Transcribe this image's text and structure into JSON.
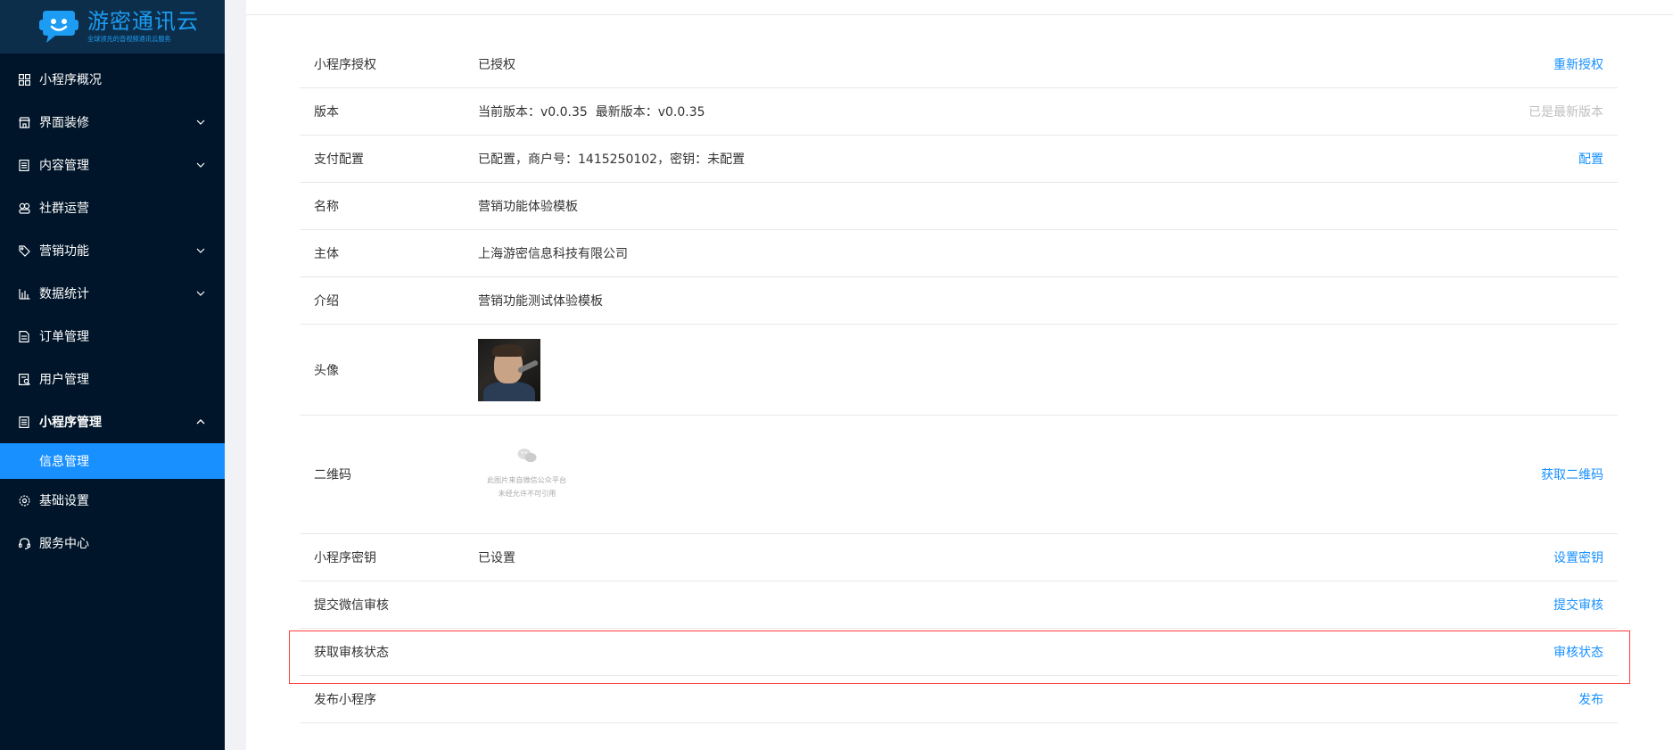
{
  "brand": {
    "title": "游密通讯云",
    "subtitle": "全球领先的音视频通讯云服务"
  },
  "colors": {
    "sidebar_bg": "#001529",
    "active_bg": "#1890ff",
    "link": "#1890ff",
    "highlight_border": "#ff3b3b"
  },
  "sidebar": {
    "items": [
      {
        "label": "小程序概况",
        "icon": "dashboard-icon",
        "chevron": false
      },
      {
        "label": "界面装修",
        "icon": "shop-icon",
        "chevron": true
      },
      {
        "label": "内容管理",
        "icon": "document-icon",
        "chevron": true
      },
      {
        "label": "社群运营",
        "icon": "community-icon",
        "chevron": false
      },
      {
        "label": "营销功能",
        "icon": "tag-icon",
        "chevron": true
      },
      {
        "label": "数据统计",
        "icon": "bar-chart-icon",
        "chevron": true
      },
      {
        "label": "订单管理",
        "icon": "order-icon",
        "chevron": false
      },
      {
        "label": "用户管理",
        "icon": "user-manage-icon",
        "chevron": false
      },
      {
        "label": "小程序管理",
        "icon": "miniprogram-icon",
        "chevron": "up"
      },
      {
        "label": "基础设置",
        "icon": "gear-icon",
        "chevron": false
      },
      {
        "label": "服务中心",
        "icon": "headset-icon",
        "chevron": false
      }
    ],
    "submenu_active": "信息管理"
  },
  "info": {
    "rows": {
      "auth": {
        "label": "小程序授权",
        "value": "已授权",
        "action": "重新授权"
      },
      "version": {
        "label": "版本",
        "value": "当前版本：v0.0.35  最新版本：v0.0.35",
        "action": "已是最新版本"
      },
      "payment": {
        "label": "支付配置",
        "value": "已配置，商户号：1415250102，密钥：未配置",
        "action": "配置"
      },
      "name": {
        "label": "名称",
        "value": "营销功能体验模板"
      },
      "subject": {
        "label": "主体",
        "value": "上海游密信息科技有限公司"
      },
      "intro": {
        "label": "介绍",
        "value": "营销功能测试体验模板"
      },
      "avatar": {
        "label": "头像"
      },
      "qrcode": {
        "label": "二维码",
        "placeholder_line1": "此图片来自微信公众平台",
        "placeholder_line2": "未经允许不可引用",
        "action": "获取二维码"
      },
      "secret": {
        "label": "小程序密钥",
        "value": "已设置",
        "action": "设置密钥"
      },
      "submit": {
        "label": "提交微信审核",
        "action": "提交审核"
      },
      "status": {
        "label": "获取审核状态",
        "action": "审核状态"
      },
      "publish": {
        "label": "发布小程序",
        "action": "发布"
      }
    }
  }
}
